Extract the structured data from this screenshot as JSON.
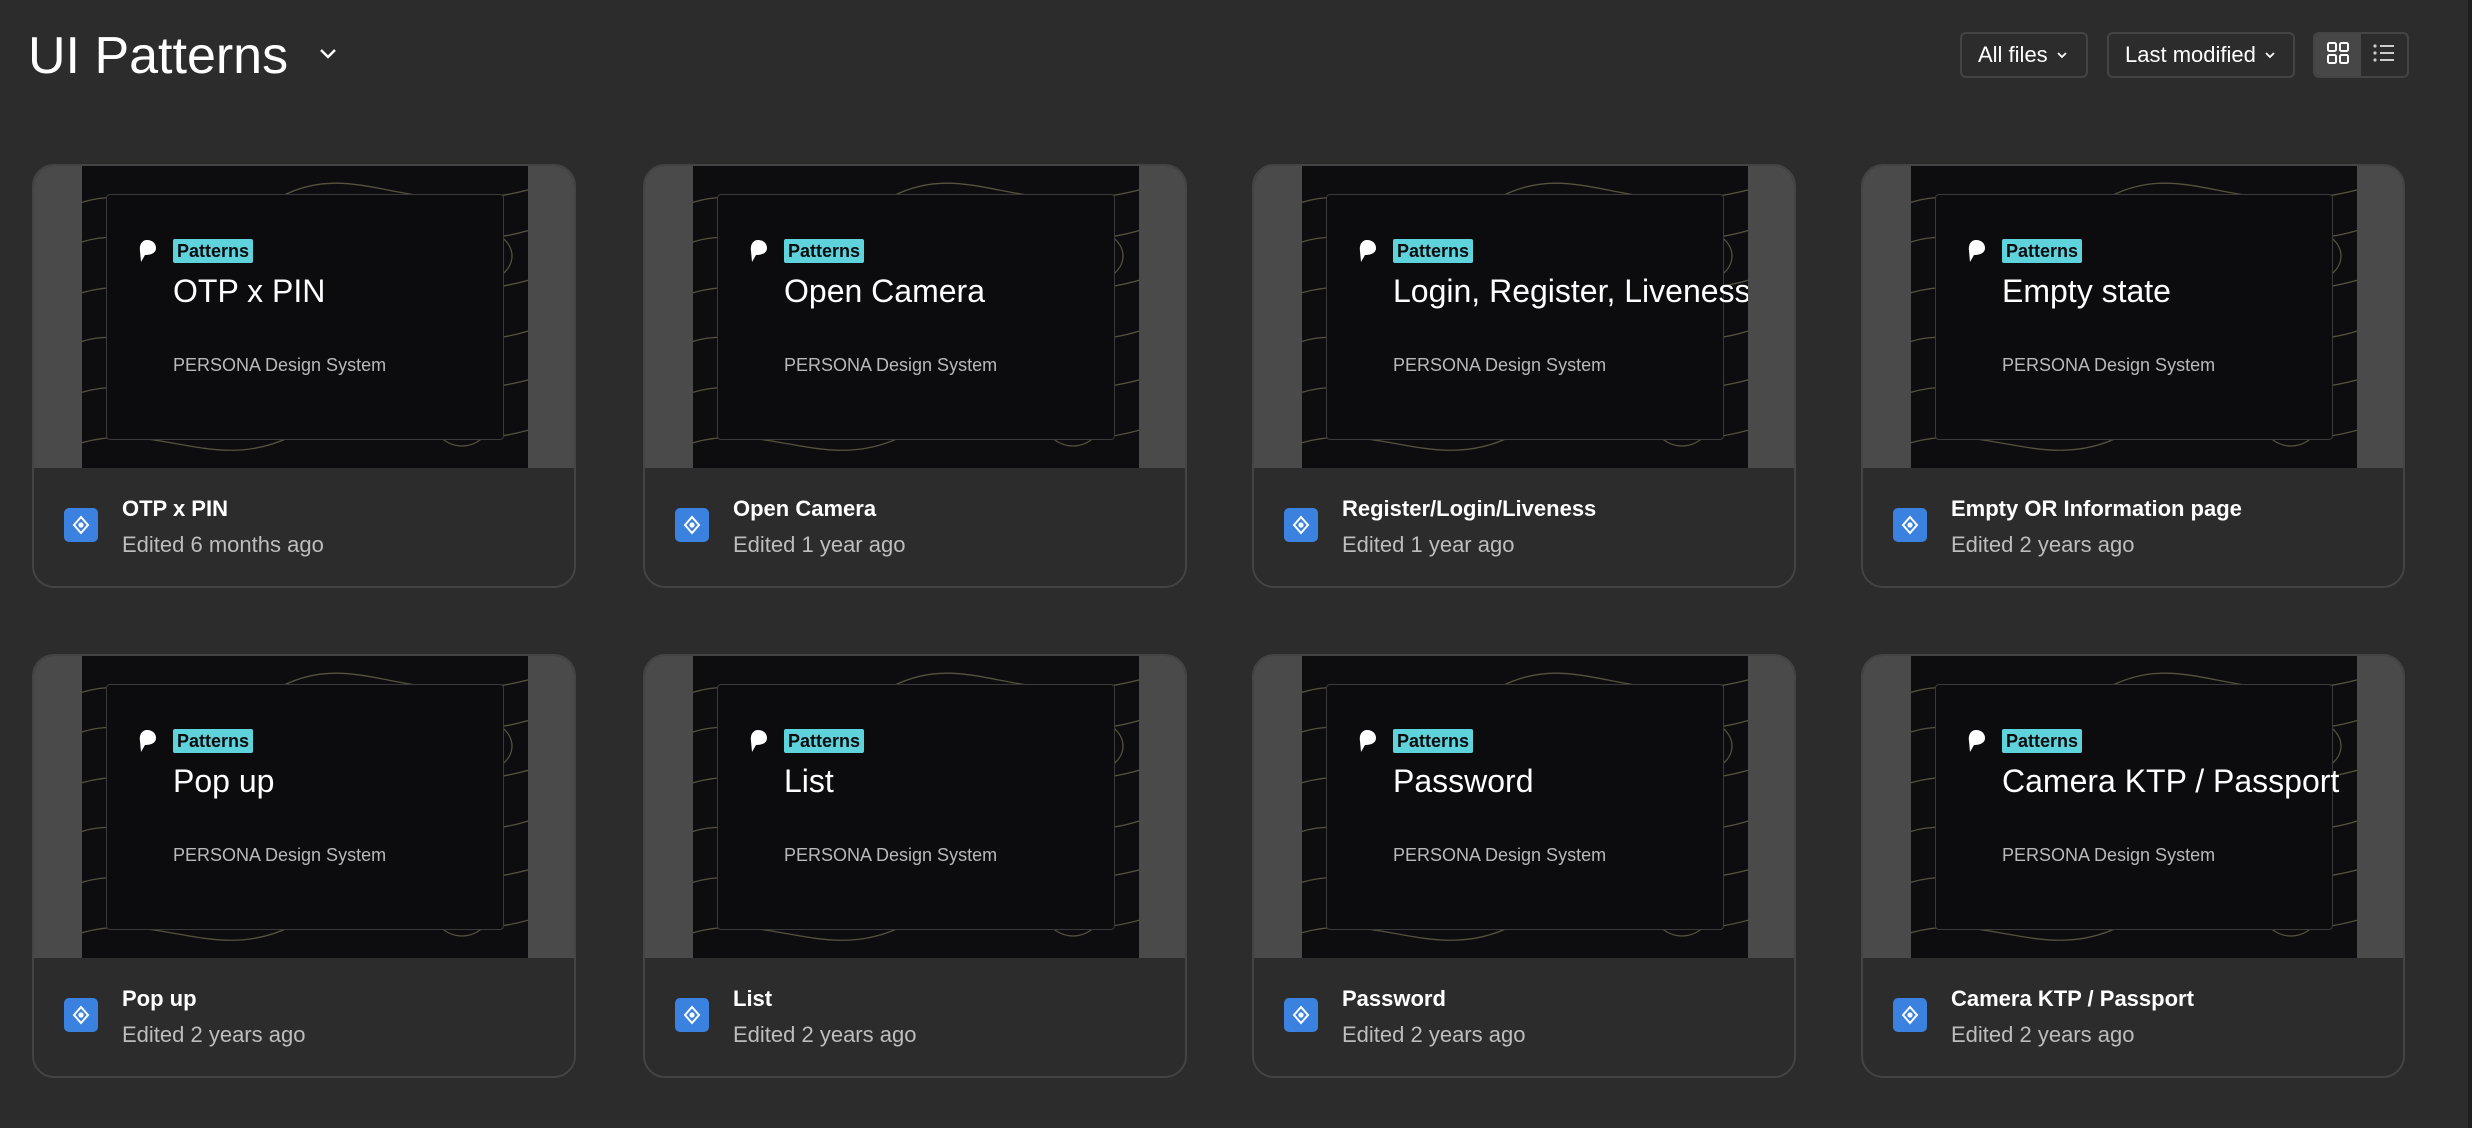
{
  "header": {
    "title": "UI Patterns",
    "filter_label": "All files",
    "sort_label": "Last modified"
  },
  "cards": [
    {
      "tag": "Patterns",
      "cover_title": "OTP x PIN",
      "cover_subtitle": "PERSONA Design System",
      "name": "OTP x PIN",
      "edited": "Edited 6 months ago"
    },
    {
      "tag": "Patterns",
      "cover_title": "Open Camera",
      "cover_subtitle": "PERSONA Design System",
      "name": "Open Camera",
      "edited": "Edited 1 year ago"
    },
    {
      "tag": "Patterns",
      "cover_title": "Login, Register, Liveness",
      "cover_subtitle": "PERSONA Design System",
      "name": "Register/Login/Liveness",
      "edited": "Edited 1 year ago"
    },
    {
      "tag": "Patterns",
      "cover_title": "Empty state",
      "cover_subtitle": "PERSONA Design System",
      "name": "Empty OR Information page",
      "edited": "Edited 2 years ago"
    },
    {
      "tag": "Patterns",
      "cover_title": "Pop up",
      "cover_subtitle": "PERSONA Design System",
      "name": "Pop up",
      "edited": "Edited 2 years ago"
    },
    {
      "tag": "Patterns",
      "cover_title": "List",
      "cover_subtitle": "PERSONA Design System",
      "name": "List",
      "edited": "Edited 2 years ago"
    },
    {
      "tag": "Patterns",
      "cover_title": "Password",
      "cover_subtitle": "PERSONA Design System",
      "name": "Password",
      "edited": "Edited 2 years ago"
    },
    {
      "tag": "Patterns",
      "cover_title": "Camera KTP / Passport",
      "cover_subtitle": "PERSONA Design System",
      "name": "Camera KTP / Passport",
      "edited": "Edited 2 years ago"
    }
  ],
  "icons": {
    "title_dropdown": "chevron-down-icon",
    "grid_view": "grid-view-icon",
    "list_view": "list-view-icon",
    "file_type": "figma-design-file-icon",
    "cover_logo": "persona-logo-icon"
  },
  "colors": {
    "background": "#2c2c2c",
    "tag_accent": "#5fd3dc",
    "file_icon": "#3b82e0"
  }
}
